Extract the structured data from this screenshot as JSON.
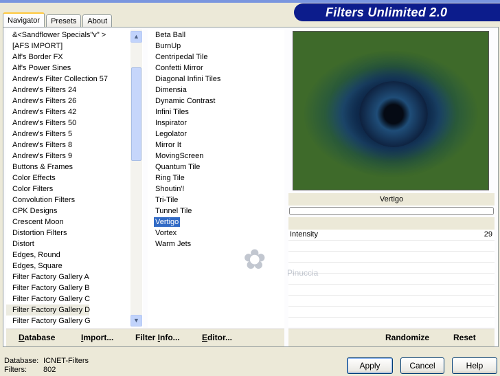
{
  "tabs": [
    {
      "label": "Navigator",
      "active": true
    },
    {
      "label": "Presets",
      "active": false
    },
    {
      "label": "About",
      "active": false
    }
  ],
  "banner": "Filters Unlimited 2.0",
  "categories": [
    "&<Sandflower Specials\"v\" >",
    "[AFS IMPORT]",
    "Alf's Border FX",
    "Alf's Power Sines",
    "Andrew's Filter Collection 57",
    "Andrew's Filters 24",
    "Andrew's Filters 26",
    "Andrew's Filters 42",
    "Andrew's Filters 50",
    "Andrew's Filters 5",
    "Andrew's Filters 8",
    "Andrew's Filters 9",
    "Buttons & Frames",
    "Color Effects",
    "Color Filters",
    "Convolution Filters",
    "CPK Designs",
    "Crescent Moon",
    "Distortion Filters",
    "Distort",
    "Edges, Round",
    "Edges, Square",
    "Filter Factory Gallery A",
    "Filter Factory Gallery B",
    "Filter Factory Gallery C",
    "Filter Factory Gallery D",
    "Filter Factory Gallery G"
  ],
  "selected_category_index": 25,
  "filters": [
    "Beta Ball",
    "BurnUp",
    "Centripedal Tile",
    "Confetti Mirror",
    "Diagonal Infini Tiles",
    "Dimensia",
    "Dynamic Contrast",
    "Infini Tiles",
    "Inspirator",
    "Legolator",
    "Mirror It",
    "MovingScreen",
    "Quantum Tile",
    "Ring Tile",
    "Shoutin'!",
    "Tri-Tile",
    "Tunnel Tile",
    "Vertigo",
    "Vortex",
    "Warm Jets"
  ],
  "selected_filter_index": 17,
  "preview": {
    "filter_name": "Vertigo"
  },
  "params": [
    {
      "label": "Intensity",
      "value": "29"
    }
  ],
  "left_buttons": {
    "database": {
      "u": "D",
      "rest": "atabase"
    },
    "import": {
      "u": "I",
      "rest": "mport..."
    },
    "filter_info": {
      "pre": "Filter ",
      "u": "I",
      "rest": "nfo..."
    },
    "editor": {
      "u": "E",
      "rest": "ditor..."
    }
  },
  "right_buttons": {
    "randomize": "Randomize",
    "reset": "Reset"
  },
  "status": {
    "database_label": "Database:",
    "database_value": "ICNET-Filters",
    "filters_label": "Filters:",
    "filters_value": "802"
  },
  "dialog_buttons": {
    "apply": "Apply",
    "cancel": "Cancel",
    "help": "Help"
  },
  "watermark": "Pinuccia",
  "scroll_icons": {
    "up": "chevron-up-icon",
    "down": "chevron-down-icon"
  }
}
